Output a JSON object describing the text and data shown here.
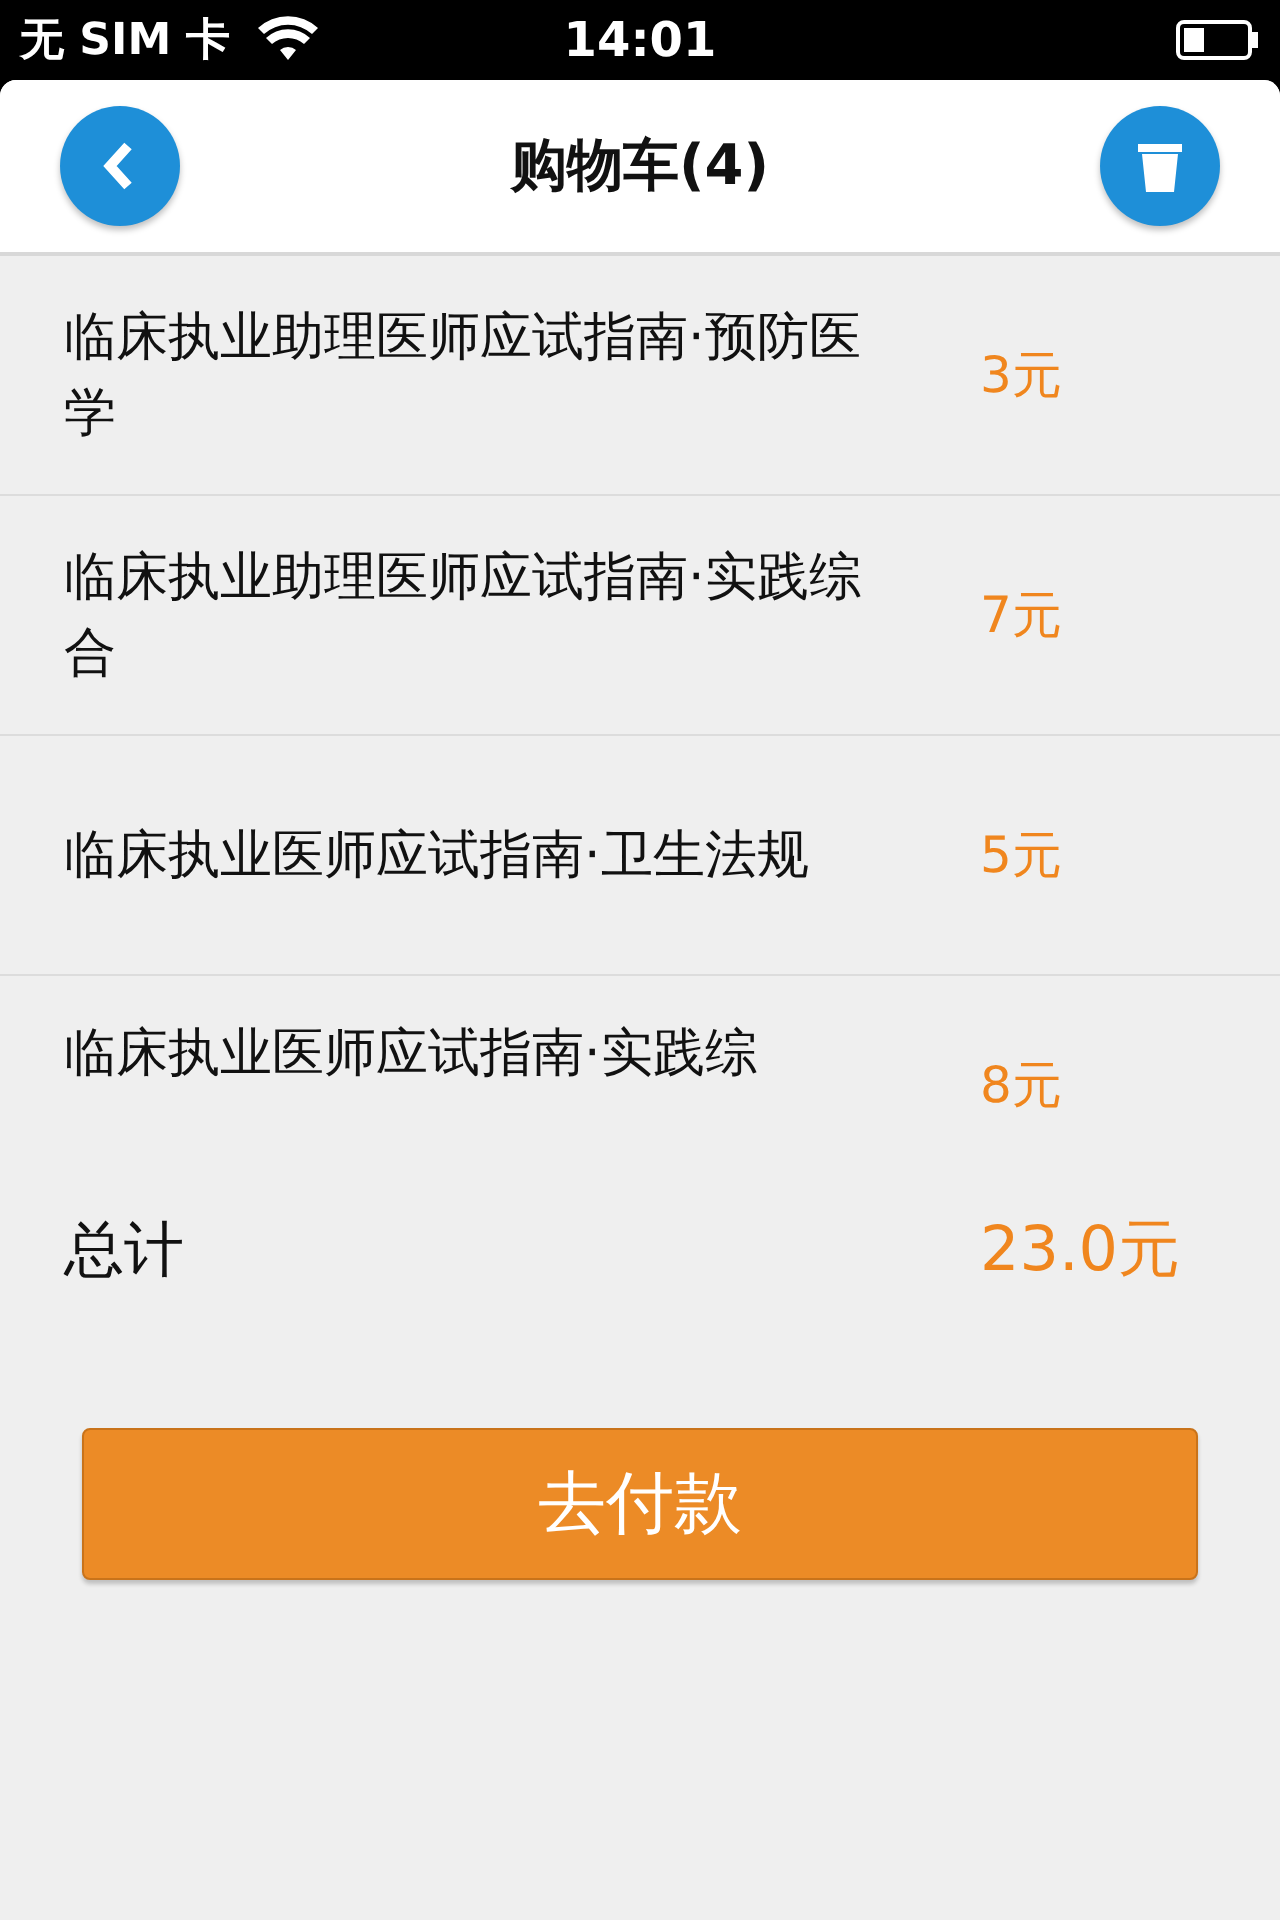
{
  "status_bar": {
    "carrier": "无 SIM 卡",
    "time": "14:01"
  },
  "header": {
    "title": "购物车(4)"
  },
  "items": [
    {
      "title": "临床执业助理医师应试指南·预防医学",
      "price": "3元"
    },
    {
      "title": "临床执业助理医师应试指南·实践综合",
      "price": "7元"
    },
    {
      "title": "临床执业医师应试指南·卫生法规",
      "price": "5元"
    },
    {
      "title": "临床执业医师应试指南·实践综",
      "price": "8元"
    }
  ],
  "total": {
    "label": "总计",
    "amount": "23.0元"
  },
  "pay_button": {
    "label": "去付款"
  }
}
